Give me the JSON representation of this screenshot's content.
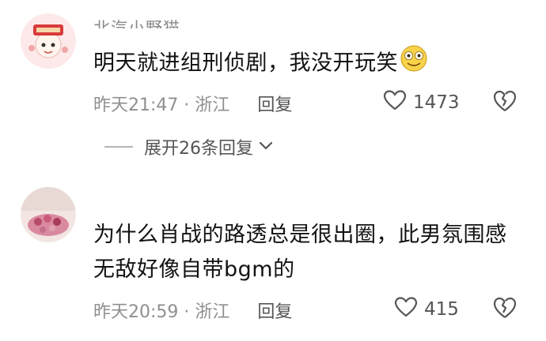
{
  "comments": [
    {
      "username": "北汽小野猫",
      "text": "明天就进组刑侦剧，我没开玩笑",
      "emoji": "flushed-smile-emoji",
      "time": "昨天21:47",
      "location": "浙江",
      "reply_label": "回复",
      "likes": "1473"
    },
    {
      "username": "",
      "text_line1": "为什么肖战的路透总是很出圈，此男氛围感",
      "text_line2": "无敌好像自带bgm的",
      "time": "昨天20:59",
      "location": "浙江",
      "reply_label": "回复",
      "likes": "415"
    }
  ],
  "expand_replies": "展开26条回复",
  "icons": {
    "like": "heart-outline-icon",
    "dislike": "broken-heart-icon",
    "expand": "chevron-down-icon"
  },
  "colors": {
    "text": "#121212",
    "meta": "#8f8f8f",
    "icon": "#555555"
  }
}
